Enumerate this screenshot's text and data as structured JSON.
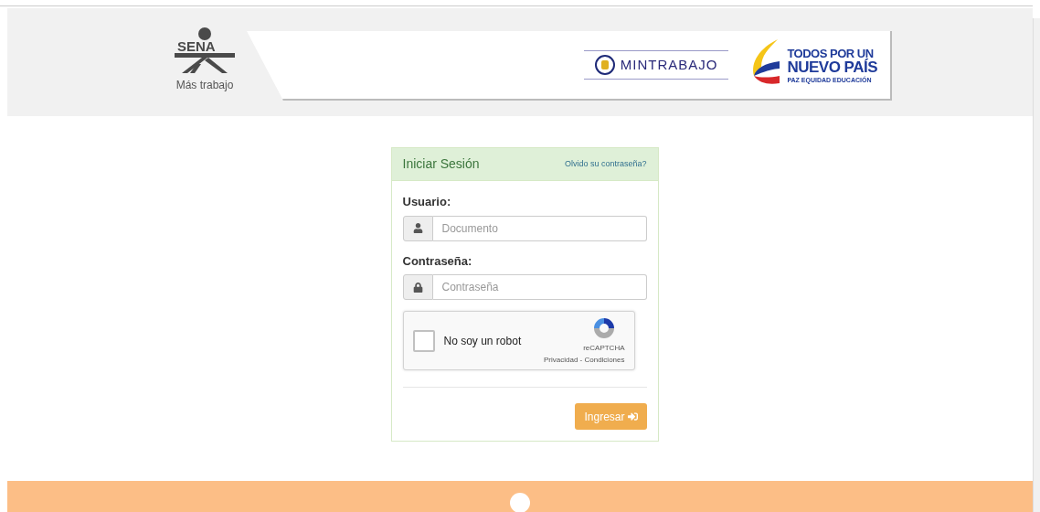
{
  "header": {
    "sena_logo": {
      "text": "SENA",
      "tagline": "Más trabajo"
    },
    "ministry_logo": {
      "text": "MINTRABAJO"
    },
    "campaign_logo": {
      "line_1": "TODOS POR UN",
      "line_2": "NUEVO PAÍS",
      "line_3": "PAZ  EQUIDAD  EDUCACIÓN"
    }
  },
  "login": {
    "title": "Iniciar Sesión",
    "forgot_link": "Olvido su contraseña?",
    "fields": [
      {
        "label": "Usuario:",
        "placeholder": "Documento",
        "kind": "user"
      },
      {
        "label": "Contraseña:",
        "placeholder": "Contraseña",
        "kind": "password"
      }
    ],
    "captcha": {
      "label": "No soy un robot",
      "checked": false,
      "brand": "reCAPTCHA",
      "links": "Privacidad - Condiciones"
    },
    "submit": "Ingresar"
  }
}
